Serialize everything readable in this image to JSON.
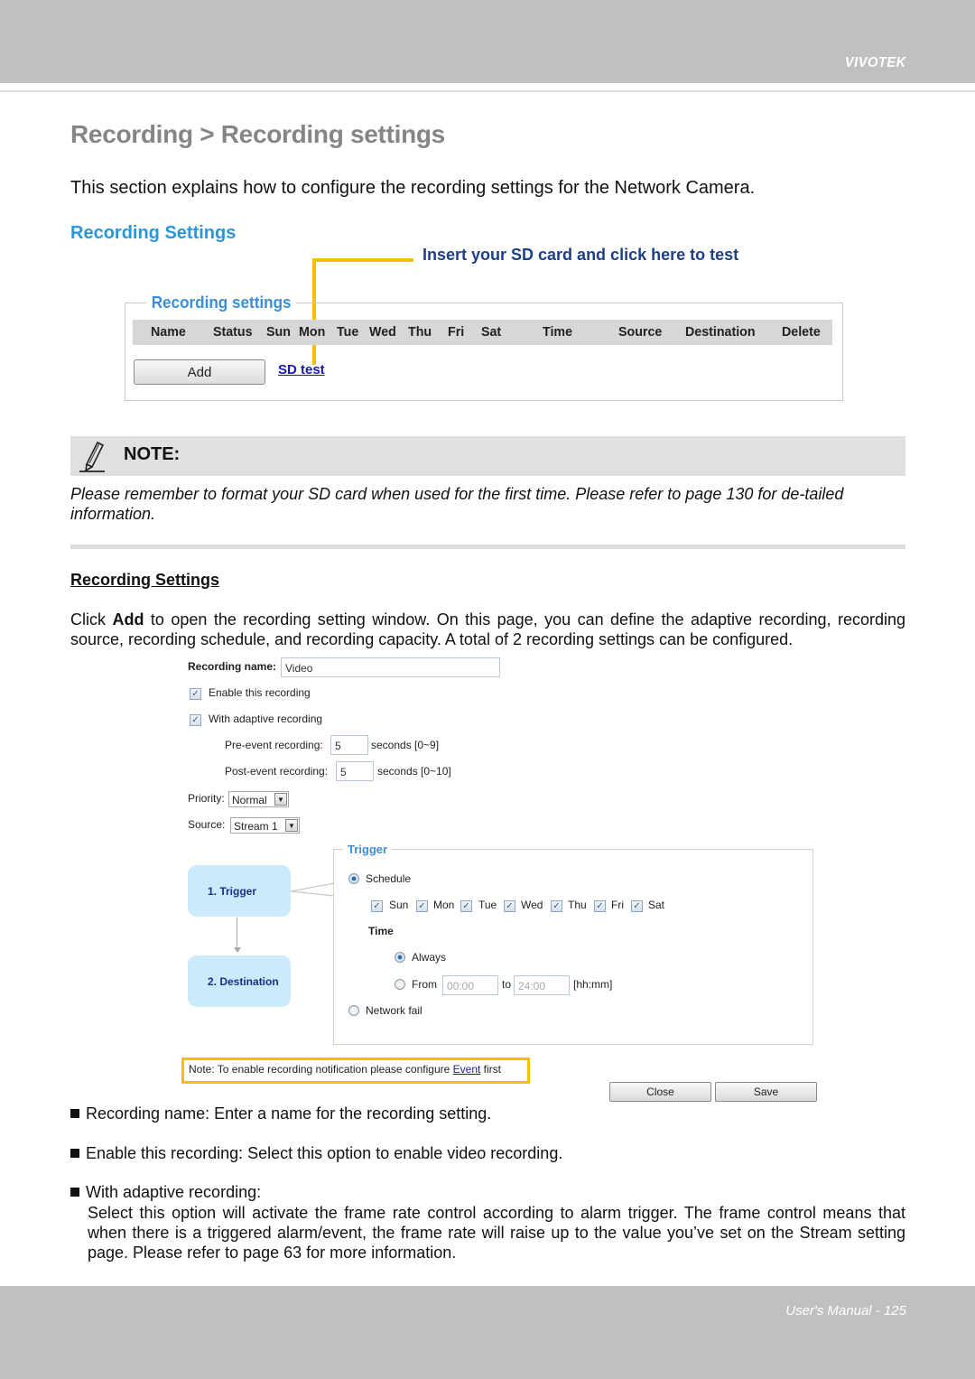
{
  "header": {
    "brand": "VIVOTEK"
  },
  "page_title": "Recording > Recording settings",
  "intro": "This section explains how to configure the recording settings for the Network Camera.",
  "section_heading": "Recording Settings",
  "callout": "Insert your SD card and click here to test",
  "recording_settings_panel": {
    "legend": "Recording settings",
    "columns": [
      "Name",
      "Status",
      "Sun",
      "Mon",
      "Tue",
      "Wed",
      "Thu",
      "Fri",
      "Sat",
      "Time",
      "Source",
      "Destination",
      "Delete"
    ],
    "add_button": "Add",
    "sd_test_link": "SD test"
  },
  "note": {
    "label": "NOTE:",
    "text": "Please remember to format your SD card when used for the first time. Please refer to page 130 for de-tailed information."
  },
  "sub_heading": "Recording Settings",
  "body": {
    "prefix": "Click ",
    "bold": "Add",
    "suffix": " to open the recording setting window. On this page, you can define the adaptive recording, recording source, recording schedule, and recording capacity. A total of 2 recording settings can be configured."
  },
  "form": {
    "recording_name_label": "Recording name:",
    "recording_name_value": "Video",
    "enable_label": "Enable this recording",
    "enable_checked": true,
    "adaptive_label": "With adaptive recording",
    "adaptive_checked": true,
    "pre_event_label": "Pre-event recording:",
    "pre_event_value": "5",
    "pre_event_unit": "seconds [0~9]",
    "post_event_label": "Post-event recording:",
    "post_event_value": "5",
    "post_event_unit": "seconds [0~10]",
    "priority_label": "Priority:",
    "priority_value": "Normal",
    "source_label": "Source:",
    "source_value": "Stream 1",
    "steps": [
      "1.  Trigger",
      "2.  Destination"
    ],
    "trigger": {
      "legend": "Trigger",
      "schedule_label": "Schedule",
      "schedule_selected": true,
      "days": [
        {
          "label": "Sun",
          "checked": true
        },
        {
          "label": "Mon",
          "checked": true
        },
        {
          "label": "Tue",
          "checked": true
        },
        {
          "label": "Wed",
          "checked": true
        },
        {
          "label": "Thu",
          "checked": true
        },
        {
          "label": "Fri",
          "checked": true
        },
        {
          "label": "Sat",
          "checked": true
        }
      ],
      "time_label": "Time",
      "always_label": "Always",
      "always_selected": true,
      "from_label": "From",
      "from_value": "00:00",
      "to_label": "to",
      "to_value": "24:00",
      "time_format": "[hh:mm]",
      "network_fail_label": "Network fail"
    },
    "event_note_prefix": "Note: To enable recording notification please configure ",
    "event_note_link": "Event",
    "event_note_suffix": " first",
    "close_button": "Close",
    "save_button": "Save"
  },
  "bullets": [
    "Recording name: Enter a name for the recording setting.",
    "Enable this recording: Select this option to enable video recording.",
    "With adaptive recording:"
  ],
  "adaptive_description": "Select this option will activate the frame rate control according to alarm trigger. The frame control means that when there is a triggered alarm/event, the frame rate will raise up to the value you’ve set on the Stream setting page. Please refer to page 63 for more information.",
  "footer": "User's Manual - 125"
}
